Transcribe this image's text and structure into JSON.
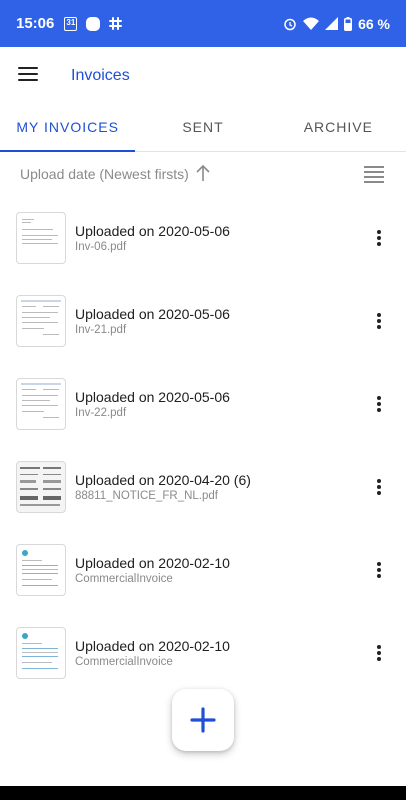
{
  "status_bar": {
    "time": "15:06",
    "calendar_day": "31",
    "battery_percent": "66 %",
    "background_color": "#2f62e6",
    "icons": [
      "calendar-icon",
      "app-icon",
      "slack-icon",
      "alarm-icon",
      "wifi-icon",
      "signal-icon",
      "battery-icon"
    ]
  },
  "app_bar": {
    "title": "Invoices",
    "menu_icon": "hamburger-menu-icon"
  },
  "tabs": [
    {
      "label": "MY INVOICES",
      "active": true
    },
    {
      "label": "SENT",
      "active": false
    },
    {
      "label": "ARCHIVE",
      "active": false
    }
  ],
  "sort": {
    "label": "Upload date (Newest firsts)",
    "direction_icon": "arrow-up-icon",
    "view_toggle_icon": "list-view-icon"
  },
  "invoices": [
    {
      "title": "Uploaded on 2020-05-06",
      "file": "Inv-06.pdf"
    },
    {
      "title": "Uploaded on 2020-05-06",
      "file": "Inv-21.pdf"
    },
    {
      "title": "Uploaded on 2020-05-06",
      "file": "Inv-22.pdf"
    },
    {
      "title": "Uploaded on 2020-04-20 (6)",
      "file": "88811_NOTICE_FR_NL.pdf"
    },
    {
      "title": "Uploaded on 2020-02-10",
      "file": "CommercialInvoice"
    },
    {
      "title": "Uploaded on 2020-02-10",
      "file": "CommercialInvoice"
    }
  ],
  "fab": {
    "icon": "plus-icon",
    "color": "#1f4fd6"
  },
  "colors": {
    "accent": "#1f4fd6",
    "secondary_text": "#8a8a8a"
  }
}
